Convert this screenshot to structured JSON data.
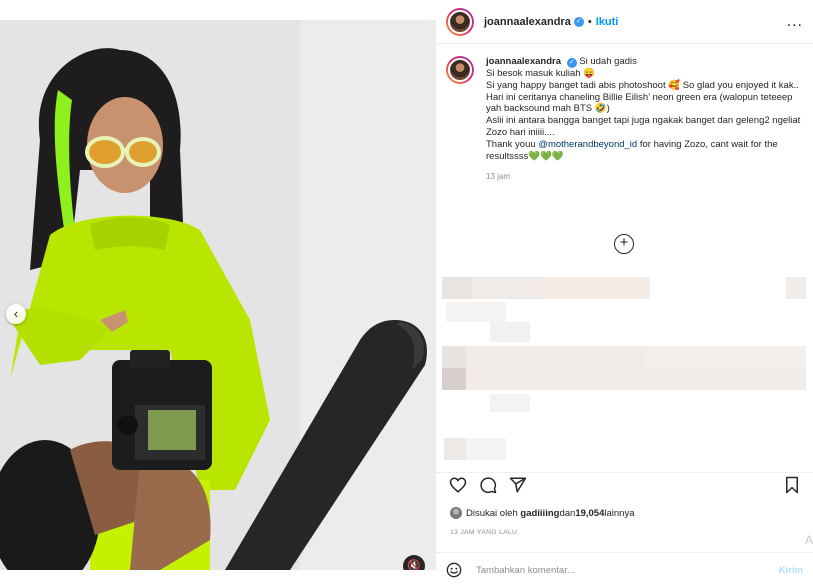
{
  "post": {
    "username": "joannaalexandra",
    "verified_mark": "✓",
    "separator": "•",
    "follow_label": "Ikuti",
    "more_label": "...",
    "caption": {
      "lines": [
        "Si udah gadis",
        "Si besok masuk kuliah 😛",
        "Si yang happy banget tadi abis photoshoot 🥰 So glad you enjoyed it kak..",
        "Hari ini ceritanya chaneling Billie Eilish’ neon green era (walopun teteeep yah backsound mah BTS 🤣)",
        "Aslii ini antara bangga banget tapi juga ngakak banget dan geleng2 ngeliat Zozo hari iniiii....",
        "Thank youu ",
        " for having Zozo, cant wait for the resultssss"
      ],
      "mention": "@motherandbeyond_id",
      "hearts": "💚💚💚",
      "time": "13 jam"
    },
    "load_more_label": "+",
    "likes": {
      "prefix": "Disukai oleh ",
      "user": "gadiiiing",
      "middle": " dan ",
      "count": "19,054",
      "suffix": " lainnya"
    },
    "posted_ago": "13 JAM YANG LALU",
    "comment": {
      "placeholder": "Tambahkan komentar...",
      "post_label": "Kirim"
    },
    "stray_text": "A"
  },
  "media": {
    "prev_label": "‹",
    "dots": 3,
    "active_dot": 2,
    "audio_label": "🔇",
    "accent_green": "#c5f000",
    "backdrop": "#e4e4e4"
  },
  "icons": {
    "like": "heart-icon",
    "comment": "comment-icon",
    "share": "share-icon",
    "save": "bookmark-icon",
    "emoji": "emoji-icon"
  }
}
